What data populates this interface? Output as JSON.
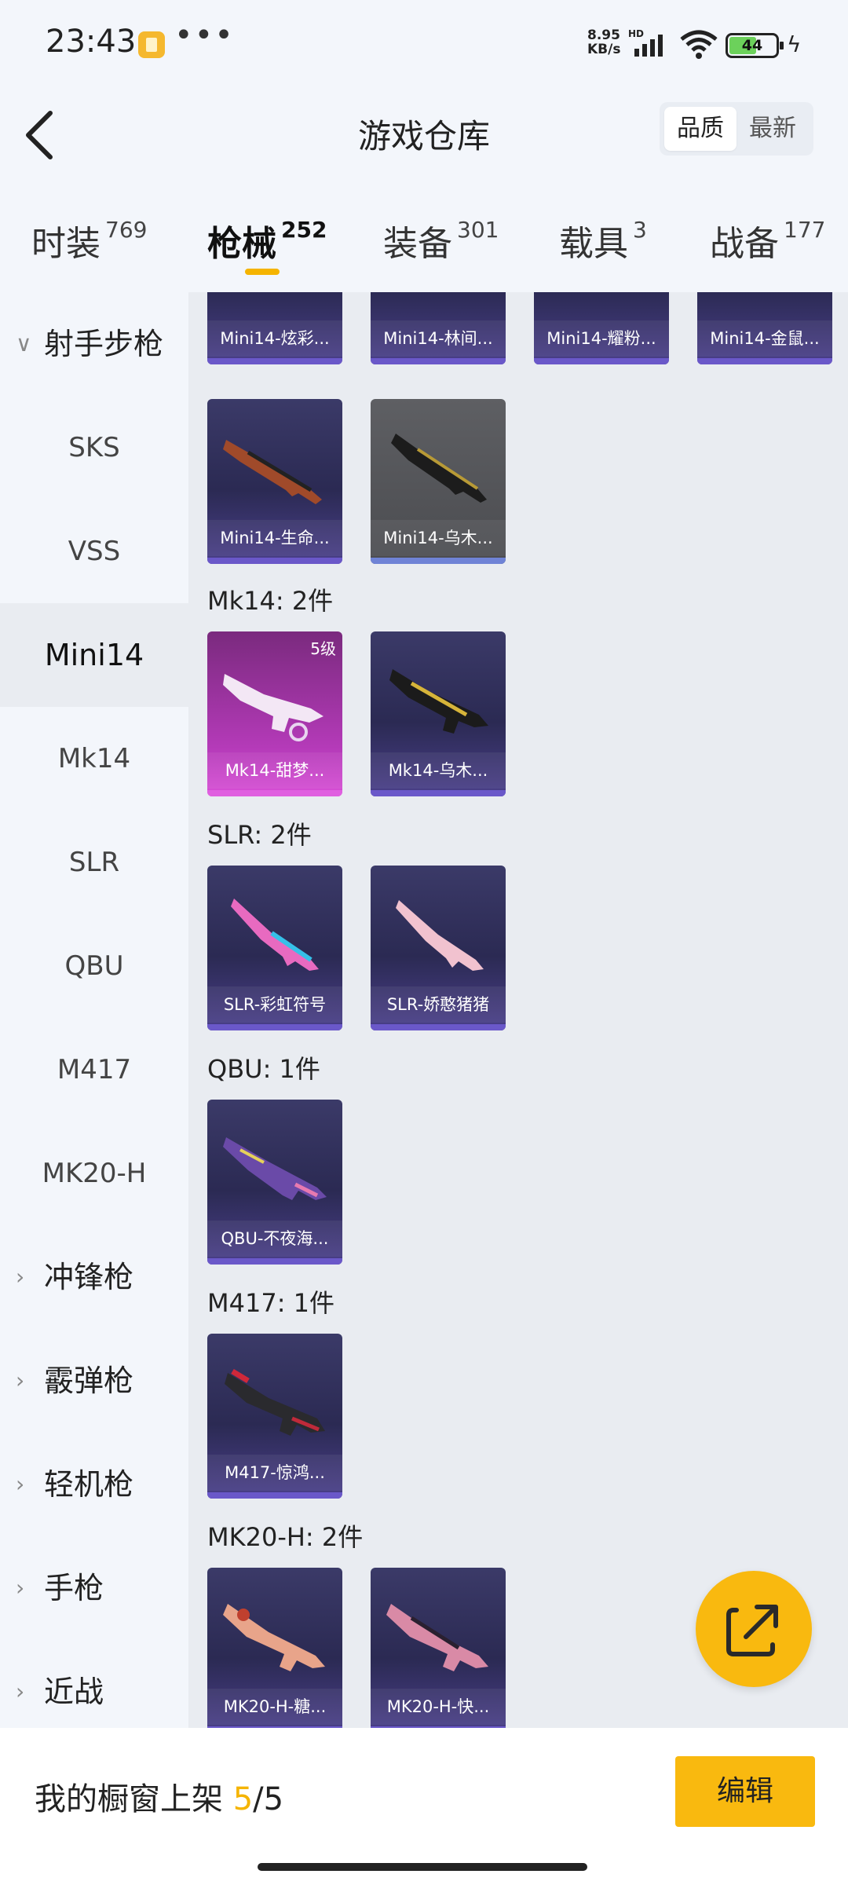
{
  "status": {
    "time": "23:43",
    "net_speed_value": "8.95",
    "net_speed_unit": "KB/s",
    "hd": "HD",
    "battery": "44",
    "more": "•••"
  },
  "header": {
    "title": "游戏仓库",
    "sort_options": [
      "品质",
      "最新"
    ]
  },
  "tabs": [
    {
      "label": "时装",
      "count": "769"
    },
    {
      "label": "枪械",
      "count": "252"
    },
    {
      "label": "装备",
      "count": "301"
    },
    {
      "label": "载具",
      "count": "3"
    },
    {
      "label": "战备",
      "count": "177"
    }
  ],
  "sidebar": {
    "group_title": "射手步枪",
    "items": [
      "SKS",
      "VSS",
      "Mini14",
      "Mk14",
      "SLR",
      "QBU",
      "M417",
      "MK20-H"
    ],
    "groups": [
      "冲锋枪",
      "霰弹枪",
      "轻机枪",
      "手枪",
      "近战"
    ]
  },
  "content": {
    "top_partial_cards": [
      "Mini14-炫彩...",
      "Mini14-林间...",
      "Mini14-耀粉...",
      "Mini14-金鼠..."
    ],
    "mini14_row2": [
      "Mini14-生命...",
      "Mini14-乌木..."
    ],
    "sections": [
      {
        "label": "Mk14: 2件",
        "cards": [
          "Mk14-甜梦...",
          "Mk14-乌木..."
        ],
        "level": "5级"
      },
      {
        "label": "SLR: 2件",
        "cards": [
          "SLR-彩虹符号",
          "SLR-娇憨猪猪"
        ]
      },
      {
        "label": "QBU: 1件",
        "cards": [
          "QBU-不夜海..."
        ]
      },
      {
        "label": "M417: 1件",
        "cards": [
          "M417-惊鸿..."
        ]
      },
      {
        "label": "MK20-H: 2件",
        "cards": [
          "MK20-H-糖...",
          "MK20-H-快..."
        ]
      }
    ]
  },
  "footer": {
    "label": "我的橱窗上架",
    "count_current": "5",
    "count_sep_total": "/5",
    "edit_label": "编辑"
  },
  "colors": {
    "accent": "#f9b90f",
    "card_purple": "#2b2a53",
    "card_pink": "#b43ab8"
  }
}
